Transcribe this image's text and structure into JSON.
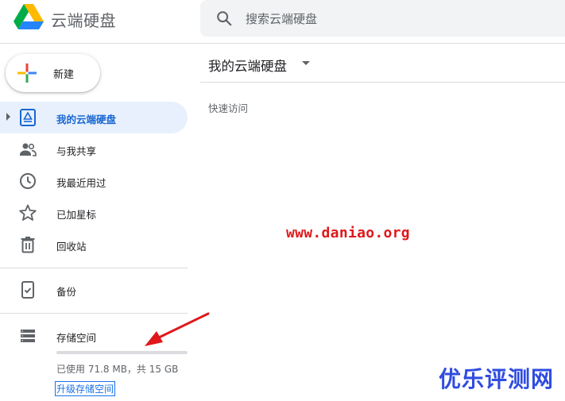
{
  "header": {
    "app_title": "云端硬盘",
    "search": {
      "placeholder": "搜索云端硬盘"
    }
  },
  "sidebar": {
    "new_button_label": "新建",
    "items": [
      {
        "label": "我的云端硬盘",
        "icon": "my-drive-icon",
        "active": true
      },
      {
        "label": "与我共享",
        "icon": "shared-people-icon",
        "active": false
      },
      {
        "label": "我最近用过",
        "icon": "clock-icon",
        "active": false
      },
      {
        "label": "已加星标",
        "icon": "star-icon",
        "active": false
      },
      {
        "label": "回收站",
        "icon": "trash-icon",
        "active": false
      }
    ],
    "backup": {
      "label": "备份",
      "icon": "backup-device-icon"
    },
    "storage": {
      "label": "存储空间",
      "icon": "storage-icon",
      "usage_text": "已使用 71.8 MB，共 15 GB",
      "used_fraction": 0.0,
      "upgrade_link": "升级存储空间"
    }
  },
  "main": {
    "title": "我的云端硬盘",
    "quick_access": "快速访问"
  },
  "overlays": {
    "watermark_url": "www.daniao.org",
    "watermark_brand": "优乐评测网"
  },
  "colors": {
    "accent_blue": "#1967d2",
    "active_bg": "#e8f0fe",
    "watermark_red": "#e0181b",
    "watermark_blue": "#2f4ce0"
  }
}
